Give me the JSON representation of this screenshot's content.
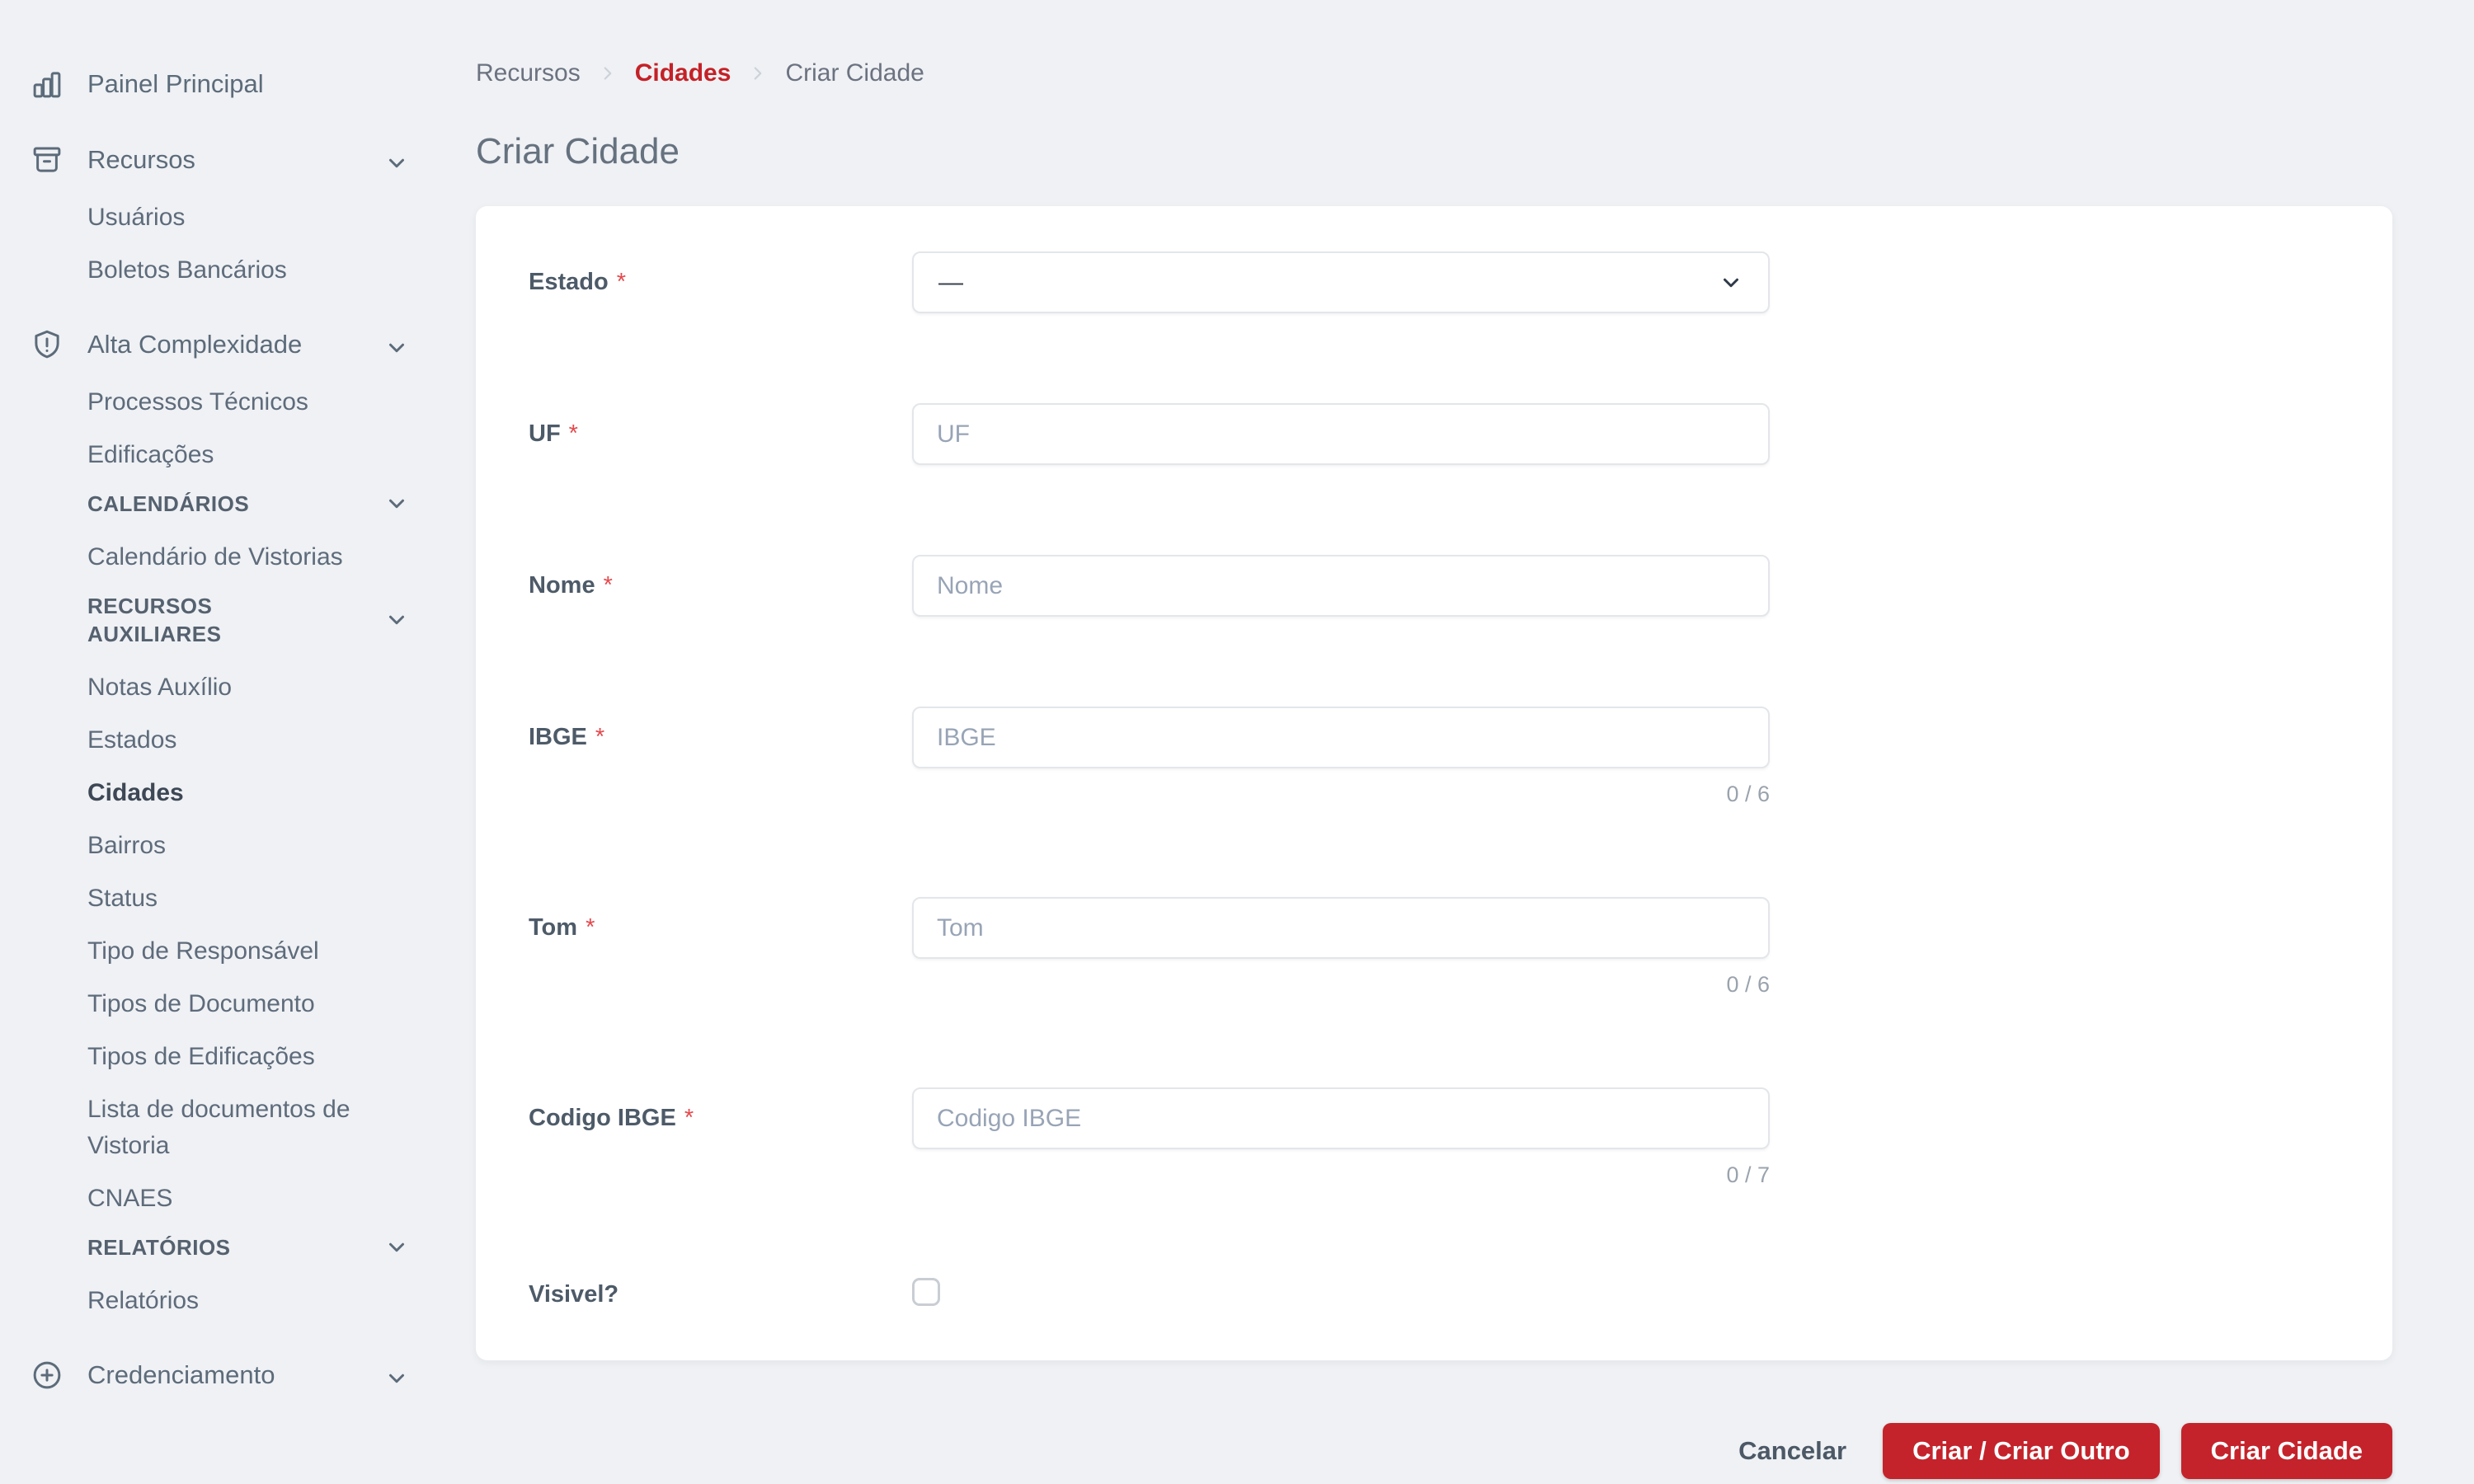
{
  "colors": {
    "accent_red": "#c4232b",
    "breadcrumb_active_red": "#c42127",
    "asterisk_red": "#e5494d",
    "background": "#eff1f4",
    "card": "#ffffff"
  },
  "sidebar": {
    "items": [
      {
        "type": "main",
        "icon": "bar-chart-icon",
        "label": "Painel Principal",
        "chevron": false,
        "group_gap": false,
        "active": false
      },
      {
        "type": "main",
        "icon": "archive-box-icon",
        "label": "Recursos",
        "chevron": true,
        "group_gap": true,
        "active": false
      },
      {
        "type": "sub",
        "label": "Usuários",
        "active": false
      },
      {
        "type": "sub",
        "label": "Boletos Bancários",
        "active": false
      },
      {
        "type": "main",
        "icon": "shield-exclamation-icon",
        "label": "Alta Complexidade",
        "chevron": true,
        "group_gap": true,
        "active": false
      },
      {
        "type": "sub",
        "label": "Processos Técnicos",
        "active": false
      },
      {
        "type": "sub",
        "label": "Edificações",
        "active": false
      },
      {
        "type": "section",
        "label": "CALENDÁRIOS",
        "chevron": true
      },
      {
        "type": "sub",
        "label": "Calendário de Vistorias",
        "active": false
      },
      {
        "type": "section",
        "label": "RECURSOS AUXILIARES",
        "chevron": true
      },
      {
        "type": "sub",
        "label": "Notas Auxílio",
        "active": false
      },
      {
        "type": "sub",
        "label": "Estados",
        "active": false
      },
      {
        "type": "sub",
        "label": "Cidades",
        "active": true
      },
      {
        "type": "sub",
        "label": "Bairros",
        "active": false
      },
      {
        "type": "sub",
        "label": "Status",
        "active": false
      },
      {
        "type": "sub",
        "label": "Tipo de Responsável",
        "active": false
      },
      {
        "type": "sub",
        "label": "Tipos de Documento",
        "active": false
      },
      {
        "type": "sub",
        "label": "Tipos de Edificações",
        "active": false
      },
      {
        "type": "sub",
        "label": "Lista de documentos de Vistoria",
        "active": false
      },
      {
        "type": "sub",
        "label": "CNAES",
        "active": false
      },
      {
        "type": "section",
        "label": "RELATÓRIOS",
        "chevron": true
      },
      {
        "type": "sub",
        "label": "Relatórios",
        "active": false
      },
      {
        "type": "main",
        "icon": "plus-circle-icon",
        "label": "Credenciamento",
        "chevron": true,
        "group_gap": true,
        "active": false
      }
    ]
  },
  "breadcrumb": {
    "items": [
      {
        "label": "Recursos",
        "active": false
      },
      {
        "label": "Cidades",
        "active": true
      },
      {
        "label": "Criar Cidade",
        "active": false
      }
    ]
  },
  "page": {
    "title": "Criar Cidade"
  },
  "form": {
    "fields": [
      {
        "label": "Estado",
        "required": true,
        "control": "select",
        "value": "—"
      },
      {
        "label": "UF",
        "required": true,
        "control": "text",
        "value": "",
        "placeholder": "UF"
      },
      {
        "label": "Nome",
        "required": true,
        "control": "text",
        "value": "",
        "placeholder": "Nome"
      },
      {
        "label": "IBGE",
        "required": true,
        "control": "text",
        "value": "",
        "placeholder": "IBGE",
        "counter": "0 / 6"
      },
      {
        "label": "Tom",
        "required": true,
        "control": "text",
        "value": "",
        "placeholder": "Tom",
        "counter": "0 / 6"
      },
      {
        "label": "Codigo IBGE",
        "required": true,
        "control": "text",
        "value": "",
        "placeholder": "Codigo IBGE",
        "counter": "0 / 7"
      },
      {
        "label": "Visivel?",
        "required": false,
        "control": "checkbox",
        "checked": false
      }
    ]
  },
  "footer": {
    "cancel_label": "Cancelar",
    "create_another_label": "Criar / Criar Outro",
    "create_label": "Criar Cidade"
  }
}
